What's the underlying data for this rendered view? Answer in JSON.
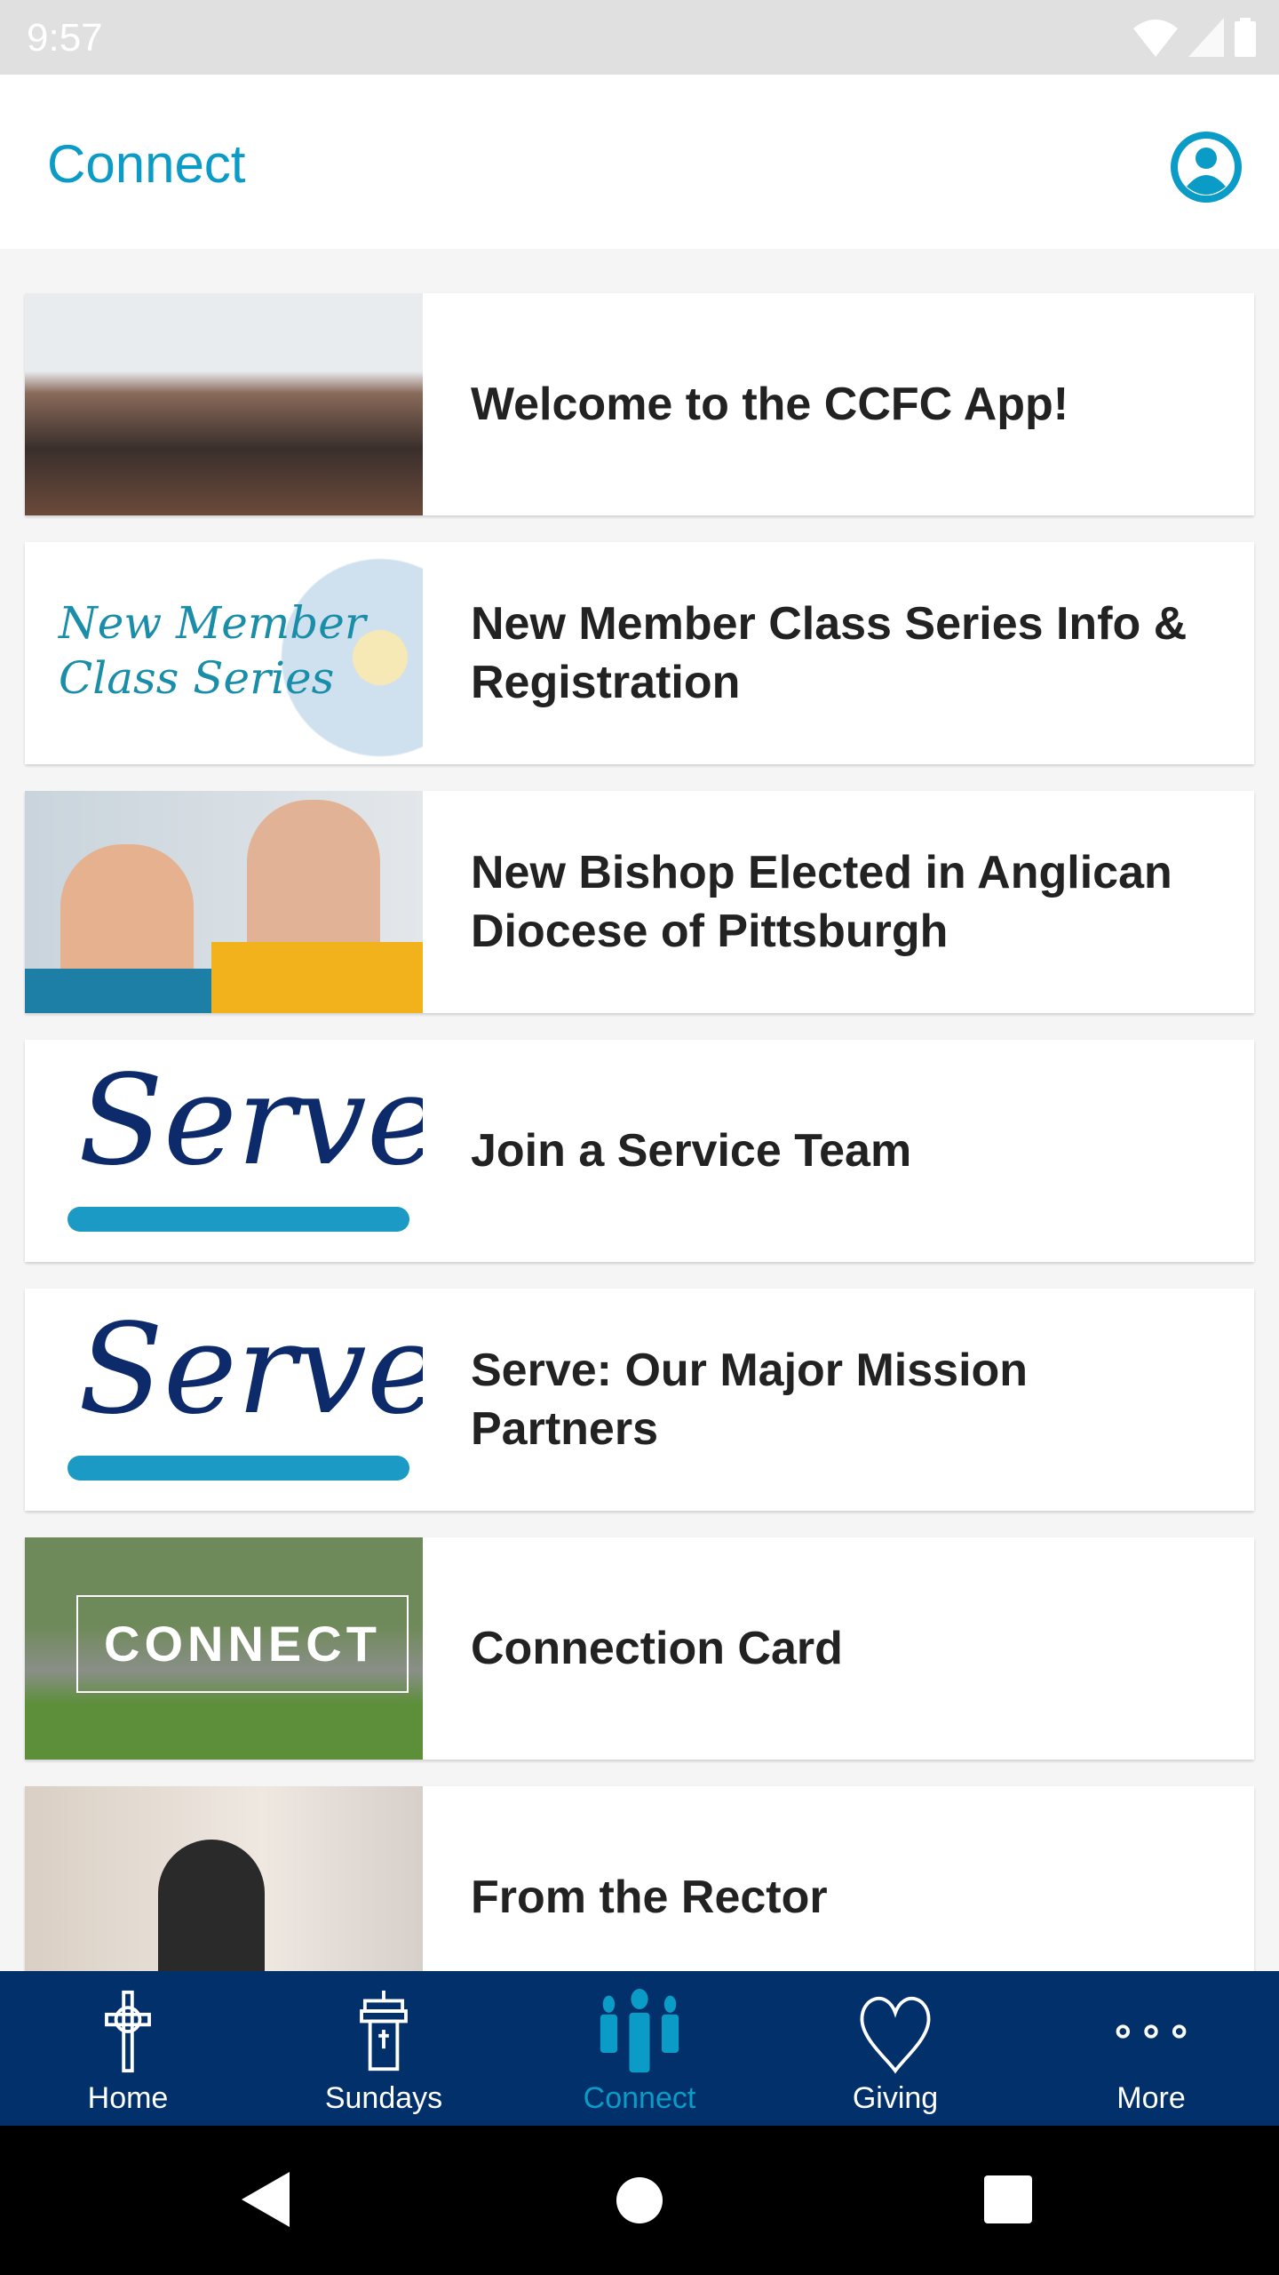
{
  "status_bar": {
    "time": "9:57"
  },
  "header": {
    "title": "Connect",
    "accent": "#0a9bc7"
  },
  "items": [
    {
      "label": "Welcome to the CCFC App!",
      "thumb": "group-photo"
    },
    {
      "label": "New Member Class Series Info & Registration",
      "thumb": "New Member Class Series",
      "thumb_line1": "New Member",
      "thumb_line2": "Class Series"
    },
    {
      "label": "New Bishop Elected in Anglican Diocese of Pittsburgh",
      "thumb": "couple-photo"
    },
    {
      "label": "Join a Service Team",
      "thumb": "Serve",
      "thumb_text": "Serve"
    },
    {
      "label": "Serve: Our Major Mission Partners",
      "thumb": "Serve",
      "thumb_text": "Serve"
    },
    {
      "label": "Connection Card",
      "thumb": "CONNECT",
      "thumb_text": "CONNECT"
    },
    {
      "label": "From the Rector",
      "thumb": "rector-photo"
    }
  ],
  "nav": {
    "items": [
      {
        "label": "Home",
        "icon": "cross-icon"
      },
      {
        "label": "Sundays",
        "icon": "pulpit-icon"
      },
      {
        "label": "Connect",
        "icon": "people-icon",
        "active": true
      },
      {
        "label": "Giving",
        "icon": "heart-icon"
      },
      {
        "label": "More",
        "icon": "more-icon"
      }
    ],
    "background": "#02306a"
  }
}
